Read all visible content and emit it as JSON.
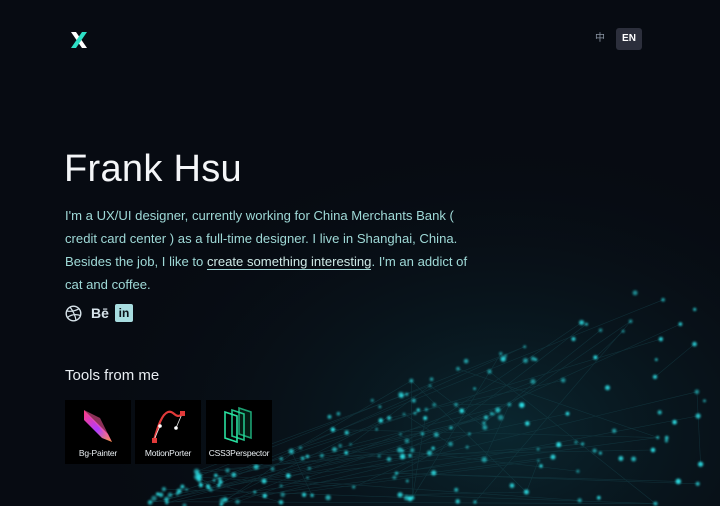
{
  "header": {
    "logo_icon": "x-logo-icon",
    "lang_zh": "中",
    "lang_en": "EN"
  },
  "hero": {
    "name": "Frank Hsu",
    "intro_before_link": "I'm a UX/UI designer, currently working for China Merchants Bank ( credit card center ) as a full-time designer. I live in Shanghai, China. Besides the job, I like to ",
    "intro_link": "create something interesting",
    "intro_after_link": ". I'm an addict of cat and coffee."
  },
  "social": {
    "dribbble_icon": "dribbble-icon",
    "behance_label": "Bē",
    "linkedin_label": "in"
  },
  "tools": {
    "title": "Tools from me",
    "items": [
      {
        "label": "Bg-Painter",
        "icon": "bg-painter-icon"
      },
      {
        "label": "MotionPorter",
        "icon": "motionporter-icon"
      },
      {
        "label": "CSS3Perspector",
        "icon": "css3perspector-icon"
      }
    ]
  },
  "colors": {
    "background": "#070b12",
    "accent": "#2de0e6",
    "intro_text": "#9fd9d7"
  }
}
